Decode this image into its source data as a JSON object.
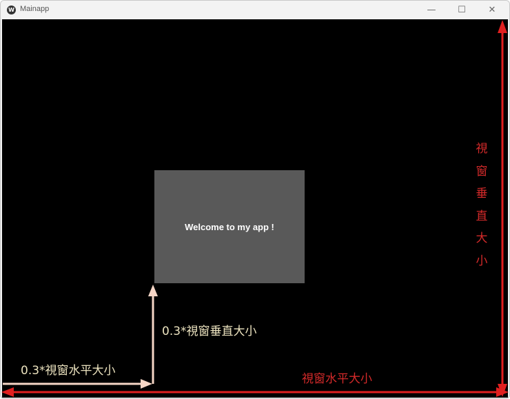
{
  "window": {
    "title": "Mainapp",
    "minimize_icon": "minimize-icon",
    "maximize_icon": "maximize-icon",
    "close_icon": "close-icon"
  },
  "app": {
    "label": "Welcome to my app !"
  },
  "annotations": {
    "horizontal_fraction": "0.3*視窗水平大小",
    "vertical_fraction": "0.3*視窗垂直大小",
    "horizontal_full": "視窗水平大小",
    "vertical_full": "視窗垂直大小"
  },
  "colors": {
    "red_arrow": "#e02020",
    "peach_arrow": "#f6d6c6",
    "box": "#595959"
  }
}
